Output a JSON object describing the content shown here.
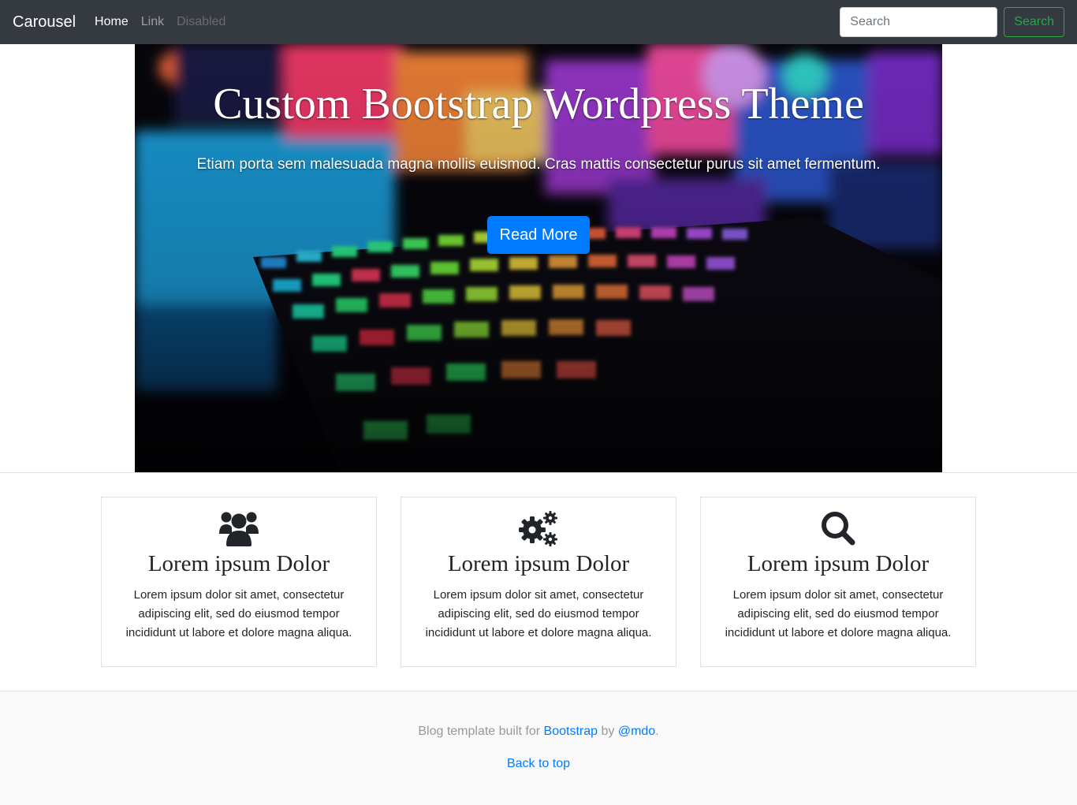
{
  "navbar": {
    "brand": "Carousel",
    "links": [
      {
        "label": "Home",
        "state": "active"
      },
      {
        "label": "Link",
        "state": "normal"
      },
      {
        "label": "Disabled",
        "state": "disabled"
      }
    ],
    "search_placeholder": "Search",
    "search_button": "Search"
  },
  "hero": {
    "title": "Custom Bootstrap Wordpress Theme",
    "subtitle": "Etiam porta sem malesuada magna mollis euismod. Cras mattis consectetur purus sit amet fermentum.",
    "button": "Read More"
  },
  "features": [
    {
      "icon": "users-icon",
      "title": "Lorem ipsum Dolor",
      "text": "Lorem ipsum dolor sit amet, consectetur adipiscing elit, sed do eiusmod tempor incididunt ut labore et dolore magna aliqua."
    },
    {
      "icon": "cogs-icon",
      "title": "Lorem ipsum Dolor",
      "text": "Lorem ipsum dolor sit amet, consectetur adipiscing elit, sed do eiusmod tempor incididunt ut labore et dolore magna aliqua."
    },
    {
      "icon": "search-icon",
      "title": "Lorem ipsum Dolor",
      "text": "Lorem ipsum dolor sit amet, consectetur adipiscing elit, sed do eiusmod tempor incididunt ut labore et dolore magna aliqua."
    }
  ],
  "footer": {
    "prefix": "Blog template built for ",
    "bootstrap_link": "Bootstrap",
    "middle": " by ",
    "author_link": "@mdo",
    "suffix": ".",
    "back_to_top": "Back to top"
  },
  "colors": {
    "navbar_bg": "#343a40",
    "primary": "#007bff",
    "success": "#28a745",
    "footer_bg": "#f9f9f9"
  }
}
